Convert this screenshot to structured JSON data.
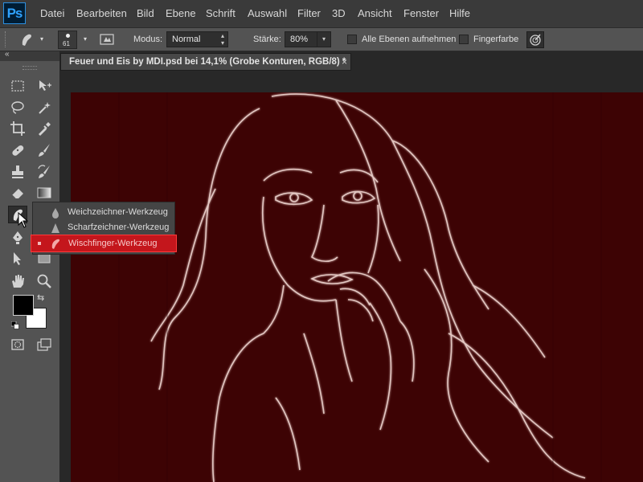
{
  "app": {
    "logo": "Ps"
  },
  "menu": [
    "Datei",
    "Bearbeiten",
    "Bild",
    "Ebene",
    "Schrift",
    "Auswahl",
    "Filter",
    "3D",
    "Ansicht",
    "Fenster",
    "Hilfe"
  ],
  "options": {
    "brush_size": "61",
    "mode_label": "Modus:",
    "mode_value": "Normal",
    "strength_label": "Stärke:",
    "strength_value": "80%",
    "all_layers_label": "Alle Ebenen aufnehmen",
    "finger_paint_label": "Fingerfarbe"
  },
  "document": {
    "tab_title": "Feuer und Eis by MDI.psd bei 14,1% (Grobe Konturen, RGB/8) *",
    "close_glyph": "×"
  },
  "flyout": {
    "items": [
      {
        "label": "Weichzeichner-Werkzeug",
        "icon": "drop-icon"
      },
      {
        "label": "Scharfzeichner-Werkzeug",
        "icon": "triangle-icon"
      },
      {
        "label": "Wischfinger-Werkzeug",
        "icon": "smudge-finger-icon",
        "active": true
      }
    ]
  },
  "colors": {
    "accent_selected": "#c4161c",
    "canvas_bg": "#3d0304",
    "ps_blue": "#2fa2ff"
  }
}
